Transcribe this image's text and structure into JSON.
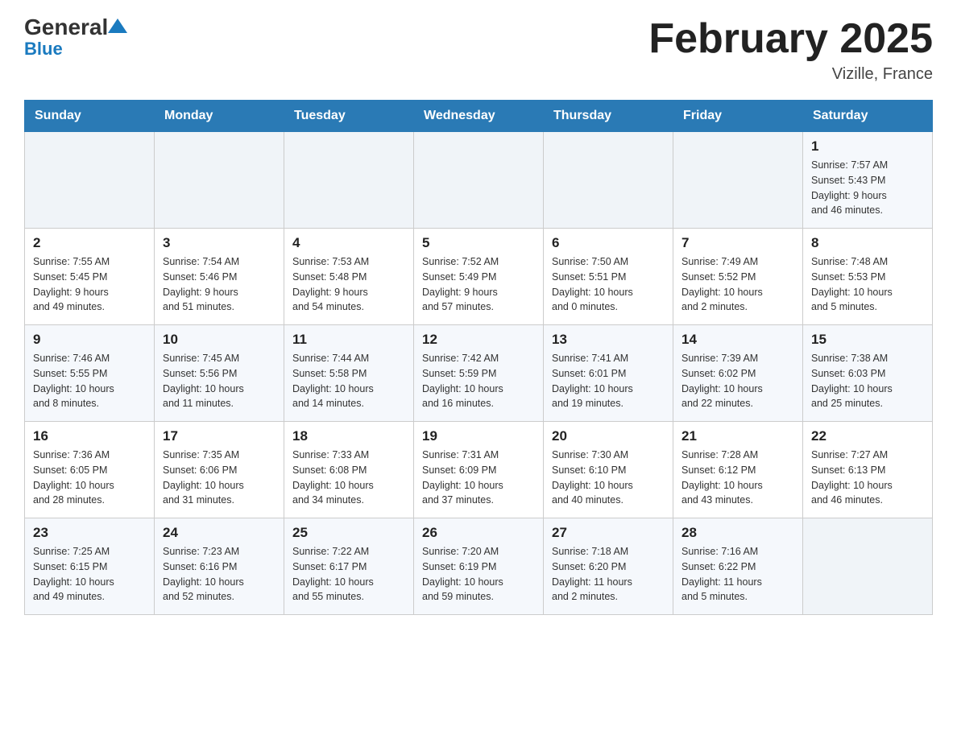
{
  "header": {
    "logo_general": "General",
    "logo_blue": "Blue",
    "title": "February 2025",
    "location": "Vizille, France"
  },
  "calendar": {
    "days_of_week": [
      "Sunday",
      "Monday",
      "Tuesday",
      "Wednesday",
      "Thursday",
      "Friday",
      "Saturday"
    ],
    "weeks": [
      [
        {
          "day": "",
          "info": ""
        },
        {
          "day": "",
          "info": ""
        },
        {
          "day": "",
          "info": ""
        },
        {
          "day": "",
          "info": ""
        },
        {
          "day": "",
          "info": ""
        },
        {
          "day": "",
          "info": ""
        },
        {
          "day": "1",
          "info": "Sunrise: 7:57 AM\nSunset: 5:43 PM\nDaylight: 9 hours\nand 46 minutes."
        }
      ],
      [
        {
          "day": "2",
          "info": "Sunrise: 7:55 AM\nSunset: 5:45 PM\nDaylight: 9 hours\nand 49 minutes."
        },
        {
          "day": "3",
          "info": "Sunrise: 7:54 AM\nSunset: 5:46 PM\nDaylight: 9 hours\nand 51 minutes."
        },
        {
          "day": "4",
          "info": "Sunrise: 7:53 AM\nSunset: 5:48 PM\nDaylight: 9 hours\nand 54 minutes."
        },
        {
          "day": "5",
          "info": "Sunrise: 7:52 AM\nSunset: 5:49 PM\nDaylight: 9 hours\nand 57 minutes."
        },
        {
          "day": "6",
          "info": "Sunrise: 7:50 AM\nSunset: 5:51 PM\nDaylight: 10 hours\nand 0 minutes."
        },
        {
          "day": "7",
          "info": "Sunrise: 7:49 AM\nSunset: 5:52 PM\nDaylight: 10 hours\nand 2 minutes."
        },
        {
          "day": "8",
          "info": "Sunrise: 7:48 AM\nSunset: 5:53 PM\nDaylight: 10 hours\nand 5 minutes."
        }
      ],
      [
        {
          "day": "9",
          "info": "Sunrise: 7:46 AM\nSunset: 5:55 PM\nDaylight: 10 hours\nand 8 minutes."
        },
        {
          "day": "10",
          "info": "Sunrise: 7:45 AM\nSunset: 5:56 PM\nDaylight: 10 hours\nand 11 minutes."
        },
        {
          "day": "11",
          "info": "Sunrise: 7:44 AM\nSunset: 5:58 PM\nDaylight: 10 hours\nand 14 minutes."
        },
        {
          "day": "12",
          "info": "Sunrise: 7:42 AM\nSunset: 5:59 PM\nDaylight: 10 hours\nand 16 minutes."
        },
        {
          "day": "13",
          "info": "Sunrise: 7:41 AM\nSunset: 6:01 PM\nDaylight: 10 hours\nand 19 minutes."
        },
        {
          "day": "14",
          "info": "Sunrise: 7:39 AM\nSunset: 6:02 PM\nDaylight: 10 hours\nand 22 minutes."
        },
        {
          "day": "15",
          "info": "Sunrise: 7:38 AM\nSunset: 6:03 PM\nDaylight: 10 hours\nand 25 minutes."
        }
      ],
      [
        {
          "day": "16",
          "info": "Sunrise: 7:36 AM\nSunset: 6:05 PM\nDaylight: 10 hours\nand 28 minutes."
        },
        {
          "day": "17",
          "info": "Sunrise: 7:35 AM\nSunset: 6:06 PM\nDaylight: 10 hours\nand 31 minutes."
        },
        {
          "day": "18",
          "info": "Sunrise: 7:33 AM\nSunset: 6:08 PM\nDaylight: 10 hours\nand 34 minutes."
        },
        {
          "day": "19",
          "info": "Sunrise: 7:31 AM\nSunset: 6:09 PM\nDaylight: 10 hours\nand 37 minutes."
        },
        {
          "day": "20",
          "info": "Sunrise: 7:30 AM\nSunset: 6:10 PM\nDaylight: 10 hours\nand 40 minutes."
        },
        {
          "day": "21",
          "info": "Sunrise: 7:28 AM\nSunset: 6:12 PM\nDaylight: 10 hours\nand 43 minutes."
        },
        {
          "day": "22",
          "info": "Sunrise: 7:27 AM\nSunset: 6:13 PM\nDaylight: 10 hours\nand 46 minutes."
        }
      ],
      [
        {
          "day": "23",
          "info": "Sunrise: 7:25 AM\nSunset: 6:15 PM\nDaylight: 10 hours\nand 49 minutes."
        },
        {
          "day": "24",
          "info": "Sunrise: 7:23 AM\nSunset: 6:16 PM\nDaylight: 10 hours\nand 52 minutes."
        },
        {
          "day": "25",
          "info": "Sunrise: 7:22 AM\nSunset: 6:17 PM\nDaylight: 10 hours\nand 55 minutes."
        },
        {
          "day": "26",
          "info": "Sunrise: 7:20 AM\nSunset: 6:19 PM\nDaylight: 10 hours\nand 59 minutes."
        },
        {
          "day": "27",
          "info": "Sunrise: 7:18 AM\nSunset: 6:20 PM\nDaylight: 11 hours\nand 2 minutes."
        },
        {
          "day": "28",
          "info": "Sunrise: 7:16 AM\nSunset: 6:22 PM\nDaylight: 11 hours\nand 5 minutes."
        },
        {
          "day": "",
          "info": ""
        }
      ]
    ]
  }
}
